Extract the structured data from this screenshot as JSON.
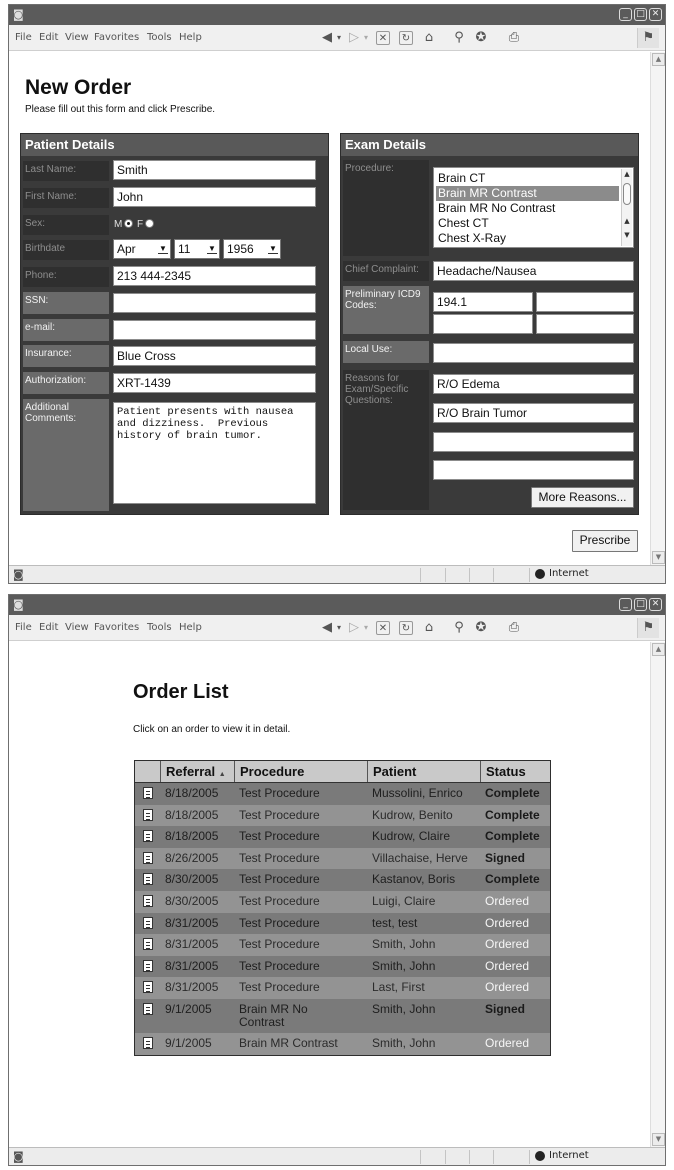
{
  "window": {
    "menu": [
      "File",
      "Edit",
      "View",
      "Favorites",
      "Tools",
      "Help"
    ],
    "status": {
      "zone": "Internet"
    }
  },
  "new_order": {
    "title": "New Order",
    "instructions": "Please fill out this form and click Prescribe.",
    "patient": {
      "heading": "Patient Details",
      "last_name_label": "Last Name:",
      "last_name": "Smith",
      "first_name_label": "First Name:",
      "first_name": "John",
      "sex_label": "Sex:",
      "sex_m": "M",
      "sex_f": "F",
      "sex_selected": "M",
      "birthdate_label": "Birthdate",
      "birth_month": "Apr",
      "birth_day": "11",
      "birth_year": "1956",
      "phone_label": "Phone:",
      "phone": "213 444-2345",
      "ssn_label": "SSN:",
      "ssn": "",
      "email_label": "e-mail:",
      "email": "",
      "insurance_label": "Insurance:",
      "insurance": "Blue Cross",
      "authorization_label": "Authorization:",
      "authorization": "XRT-1439",
      "comments_label": "Additional Comments:",
      "comments": "Patient presents with nausea\nand dizziness.  Previous\nhistory of brain tumor."
    },
    "exam": {
      "heading": "Exam Details",
      "procedure_label": "Procedure:",
      "procedures": [
        "Brain CT",
        "Brain MR Contrast",
        "Brain MR No Contrast",
        "Chest CT",
        "Chest X-Ray"
      ],
      "procedure_selected": "Brain MR Contrast",
      "complaint_label": "Chief Complaint:",
      "complaint": "Headache/Nausea",
      "icd9_label": "Preliminary ICD9 Codes:",
      "icd9": [
        "194.1",
        "",
        "",
        ""
      ],
      "local_use_label": "Local Use:",
      "local_use": "",
      "reasons_label": "Reasons for Exam/Specific Questions:",
      "reasons": [
        "R/O Edema",
        "R/O Brain Tumor",
        "",
        ""
      ],
      "more_reasons_label": "More Reasons..."
    },
    "prescribe_label": "Prescribe"
  },
  "order_list": {
    "title": "Order List",
    "instructions": "Click on an order to view it in detail.",
    "columns": [
      "Referral",
      "Procedure",
      "Patient",
      "Status"
    ],
    "sort_indicator": "▲",
    "rows": [
      {
        "referral": "8/18/2005",
        "procedure": "Test Procedure",
        "patient": "Mussolini, Enrico",
        "status": "Complete"
      },
      {
        "referral": "8/18/2005",
        "procedure": "Test Procedure",
        "patient": "Kudrow, Benito",
        "status": "Complete"
      },
      {
        "referral": "8/18/2005",
        "procedure": "Test Procedure",
        "patient": "Kudrow, Claire",
        "status": "Complete"
      },
      {
        "referral": "8/26/2005",
        "procedure": "Test Procedure",
        "patient": "Villachaise, Herve",
        "status": "Signed"
      },
      {
        "referral": "8/30/2005",
        "procedure": "Test Procedure",
        "patient": "Kastanov, Boris",
        "status": "Complete"
      },
      {
        "referral": "8/30/2005",
        "procedure": "Test Procedure",
        "patient": "Luigi, Claire",
        "status": "Ordered"
      },
      {
        "referral": "8/31/2005",
        "procedure": "Test Procedure",
        "patient": "test, test",
        "status": "Ordered"
      },
      {
        "referral": "8/31/2005",
        "procedure": "Test Procedure",
        "patient": "Smith, John",
        "status": "Ordered"
      },
      {
        "referral": "8/31/2005",
        "procedure": "Test Procedure",
        "patient": "Smith, John",
        "status": "Ordered"
      },
      {
        "referral": "8/31/2005",
        "procedure": "Test Procedure",
        "patient": "Last, First",
        "status": "Ordered"
      },
      {
        "referral": "9/1/2005",
        "procedure": "Brain MR No Contrast",
        "patient": "Smith, John",
        "status": "Signed"
      },
      {
        "referral": "9/1/2005",
        "procedure": "Brain MR Contrast",
        "patient": "Smith, John",
        "status": "Ordered"
      }
    ]
  },
  "colors": {
    "panel_bg": "#3a3a3a",
    "panel_header": "#595959",
    "row_shades": [
      "#7a7a7a",
      "#939393"
    ]
  },
  "icons": {
    "back": "back-arrow-icon",
    "forward": "forward-arrow-icon",
    "stop": "stop-icon",
    "refresh": "refresh-icon",
    "home": "home-icon",
    "search": "search-icon",
    "favorites": "favorites-icon",
    "print": "print-icon",
    "order_row": "document-icon",
    "zone": "globe-icon"
  }
}
